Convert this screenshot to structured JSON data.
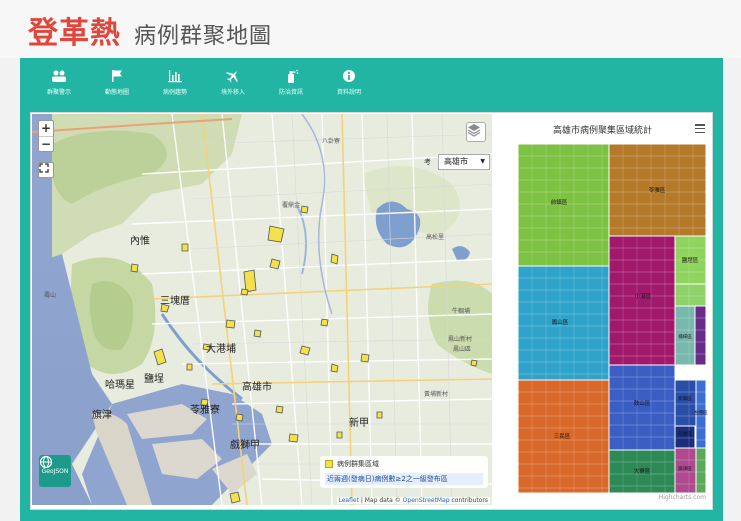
{
  "header": {
    "title_main": "登革熱",
    "title_sub": "病例群聚地圖"
  },
  "nav": [
    {
      "label": "群聚警示",
      "icon": "users-icon"
    },
    {
      "label": "動態地圖",
      "icon": "flag-icon"
    },
    {
      "label": "病例趨勢",
      "icon": "bar-chart-icon"
    },
    {
      "label": "境外移入",
      "icon": "plane-icon"
    },
    {
      "label": "防治資訊",
      "icon": "spray-icon"
    },
    {
      "label": "資料說明",
      "icon": "info-icon"
    }
  ],
  "map": {
    "zoom_in": "+",
    "zoom_out": "−",
    "city_prefix": "考",
    "city_select": "高雄市",
    "legend_label": "病例群集區域",
    "legend_note": "近兩週(發病日)病例數≥2之一級發布區",
    "attribution_leaflet": "Leaflet",
    "attribution_mid": " | Map data © ",
    "attribution_osm": "OpenStreetMap",
    "attribution_end": " contributors",
    "geojson_label": "GeoJSON",
    "labels": [
      {
        "text": "內惟",
        "big": true
      },
      {
        "text": "三塊厝",
        "big": true
      },
      {
        "text": "大港埔",
        "big": true
      },
      {
        "text": "哈瑪星",
        "big": true
      },
      {
        "text": "鹽埕",
        "big": true
      },
      {
        "text": "高雄市",
        "big": true
      },
      {
        "text": "旗津",
        "big": true
      },
      {
        "text": "苓雅寮",
        "big": true
      },
      {
        "text": "新甲",
        "big": true
      },
      {
        "text": "戲獅甲",
        "big": true
      },
      {
        "text": "壽山",
        "big": false
      },
      {
        "text": "八卦寮",
        "big": false
      },
      {
        "text": "覆鼎金",
        "big": false
      },
      {
        "text": "高松里",
        "big": false
      },
      {
        "text": "牛稠埔",
        "big": false
      },
      {
        "text": "鳳山新村",
        "big": false
      },
      {
        "text": "黃埔新村",
        "big": false
      },
      {
        "text": "鳳山區",
        "big": false
      }
    ]
  },
  "chart_data": {
    "type": "treemap",
    "title": "高雄市病例聚集區域統計",
    "credits": "Highcharts.com",
    "menu_icon": "hamburger-icon",
    "cluster_fill": "#f2e14b",
    "series": [
      {
        "name": "前鎮區",
        "color": "#7dc243"
      },
      {
        "name": "苓雅區",
        "color": "#b47a2a"
      },
      {
        "name": "鳳山區",
        "color": "#2fa3c9"
      },
      {
        "name": "小港區",
        "color": "#a1196b"
      },
      {
        "name": "鹽埕區",
        "color": "#8fd45e"
      },
      {
        "name": "楠梓區",
        "color": "#7ab8ad"
      },
      {
        "name": "三民區",
        "color": "#d8692a"
      },
      {
        "name": "鼓山區",
        "color": "#3b5ec4"
      },
      {
        "name": "新興區",
        "color": "#2a4ea8"
      },
      {
        "name": "前金區",
        "color": "#1a2f7a"
      },
      {
        "name": "左營區",
        "color": "#3d6fd0"
      },
      {
        "name": "大寮區",
        "color": "#2d8a57"
      },
      {
        "name": "旗津區",
        "color": "#b04a8f"
      },
      {
        "name": "",
        "color": "#6a2a8a"
      },
      {
        "name": "",
        "color": "#8dd36a"
      },
      {
        "name": "",
        "color": "#5aaa5a"
      }
    ]
  }
}
